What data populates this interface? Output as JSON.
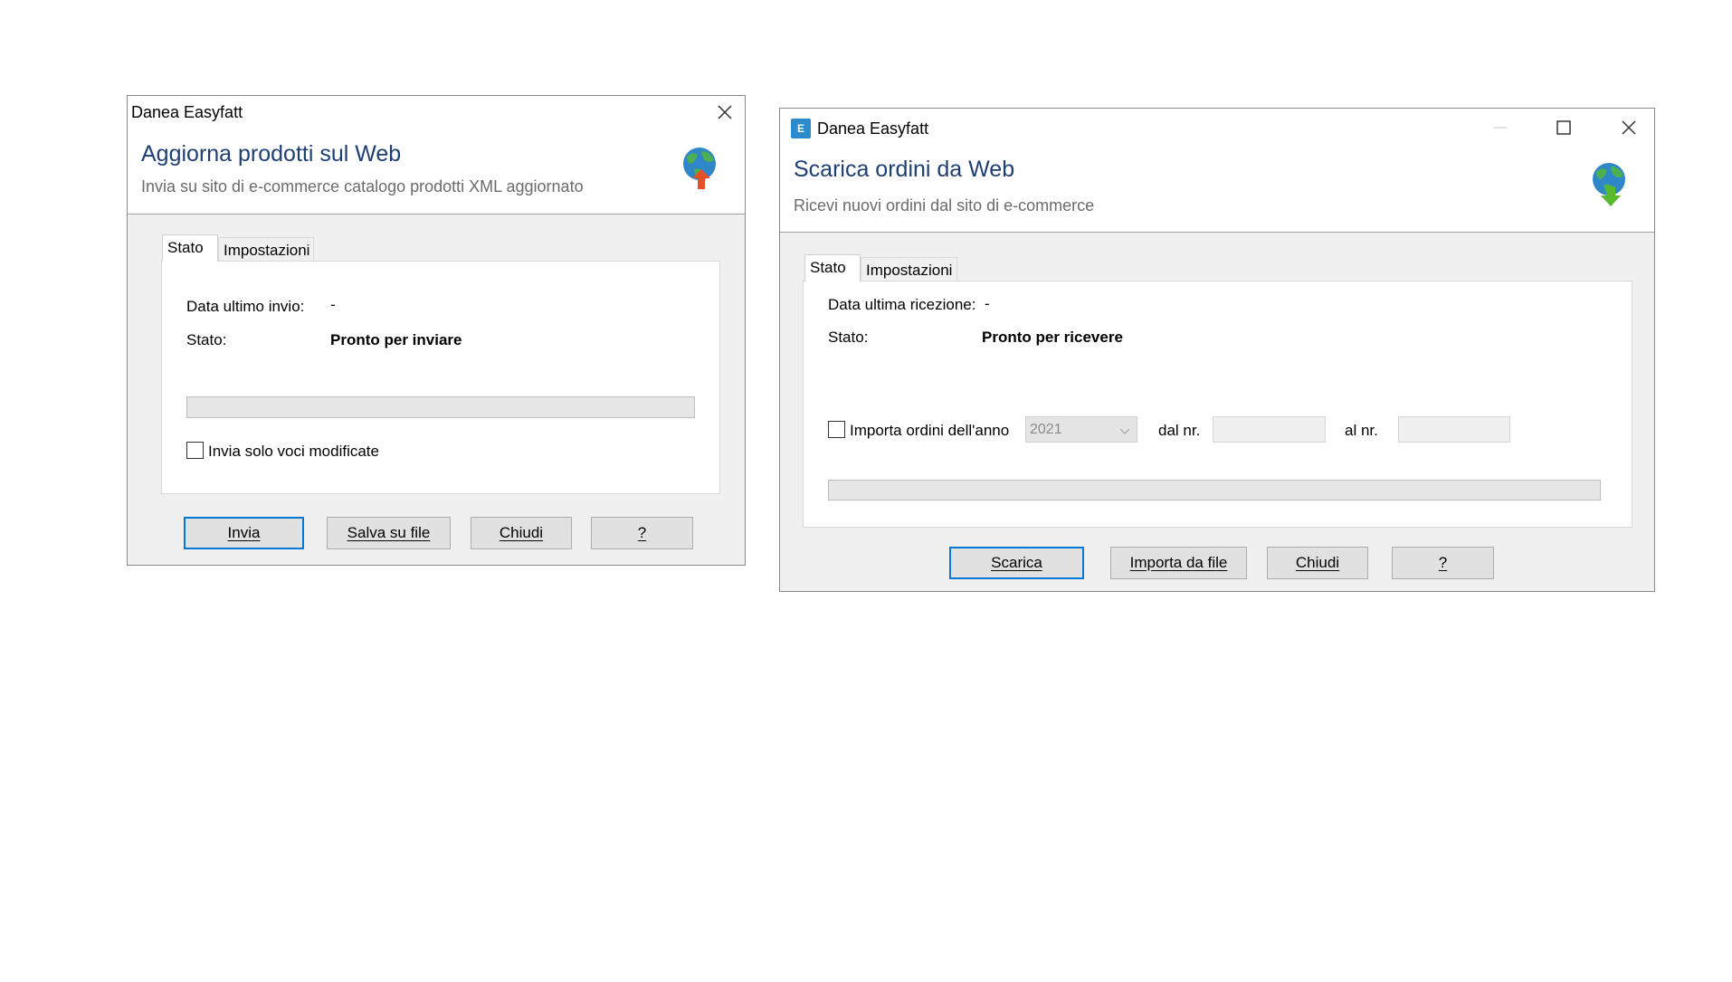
{
  "dialog_upload": {
    "window_title": "Danea Easyfatt",
    "header_title": "Aggiorna prodotti sul Web",
    "header_subtitle": "Invia su sito di e-commerce catalogo prodotti XML aggiornato",
    "header_icon": "globe-upload-icon",
    "tabs": [
      "Stato",
      "Impostazioni"
    ],
    "last_send_label": "Data ultimo invio:",
    "last_send_value": "-",
    "status_label": "Stato:",
    "status_value": "Pronto per inviare",
    "progress": 0,
    "checkbox_label": "Invia solo voci modificate",
    "checkbox_checked": false,
    "buttons": {
      "send": "Invia",
      "save": "Salva su file",
      "close": "Chiudi",
      "help": "?"
    }
  },
  "dialog_download": {
    "window_title": "Danea Easyfatt",
    "app_icon": "app-logo-icon",
    "header_title": "Scarica ordini da Web",
    "header_subtitle": "Ricevi nuovi ordini dal sito di e-commerce",
    "header_icon": "globe-download-icon",
    "tabs": [
      "Stato",
      "Impostazioni"
    ],
    "last_receive_label": "Data ultima ricezione:",
    "last_receive_value": "-",
    "status_label": "Stato:",
    "status_value": "Pronto per ricevere",
    "import_year_label": "Importa ordini dell'anno",
    "import_year_checked": false,
    "year_value": "2021",
    "from_label": "dal nr.",
    "from_value": "",
    "to_label": "al nr.",
    "to_value": "",
    "progress": 0,
    "buttons": {
      "download": "Scarica",
      "import": "Importa da file",
      "close": "Chiudi",
      "help": "?"
    }
  }
}
